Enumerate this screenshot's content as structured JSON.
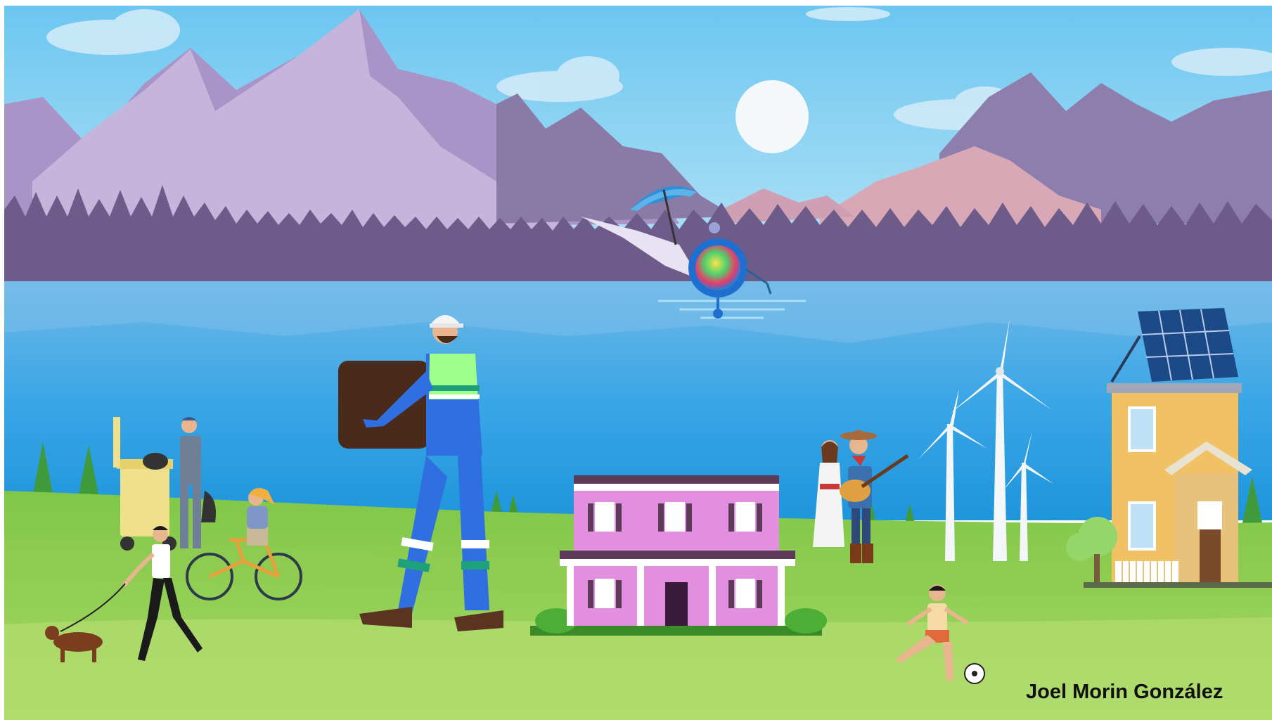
{
  "credit": {
    "author": "Joel Morin González"
  },
  "palette": {
    "sky": "#84d1f1",
    "mountain": "#b9a8d6",
    "forest": "#6d5b8a",
    "lake": "#3ea9e8",
    "grass": "#93d156",
    "sun": "#f4f7fa"
  }
}
